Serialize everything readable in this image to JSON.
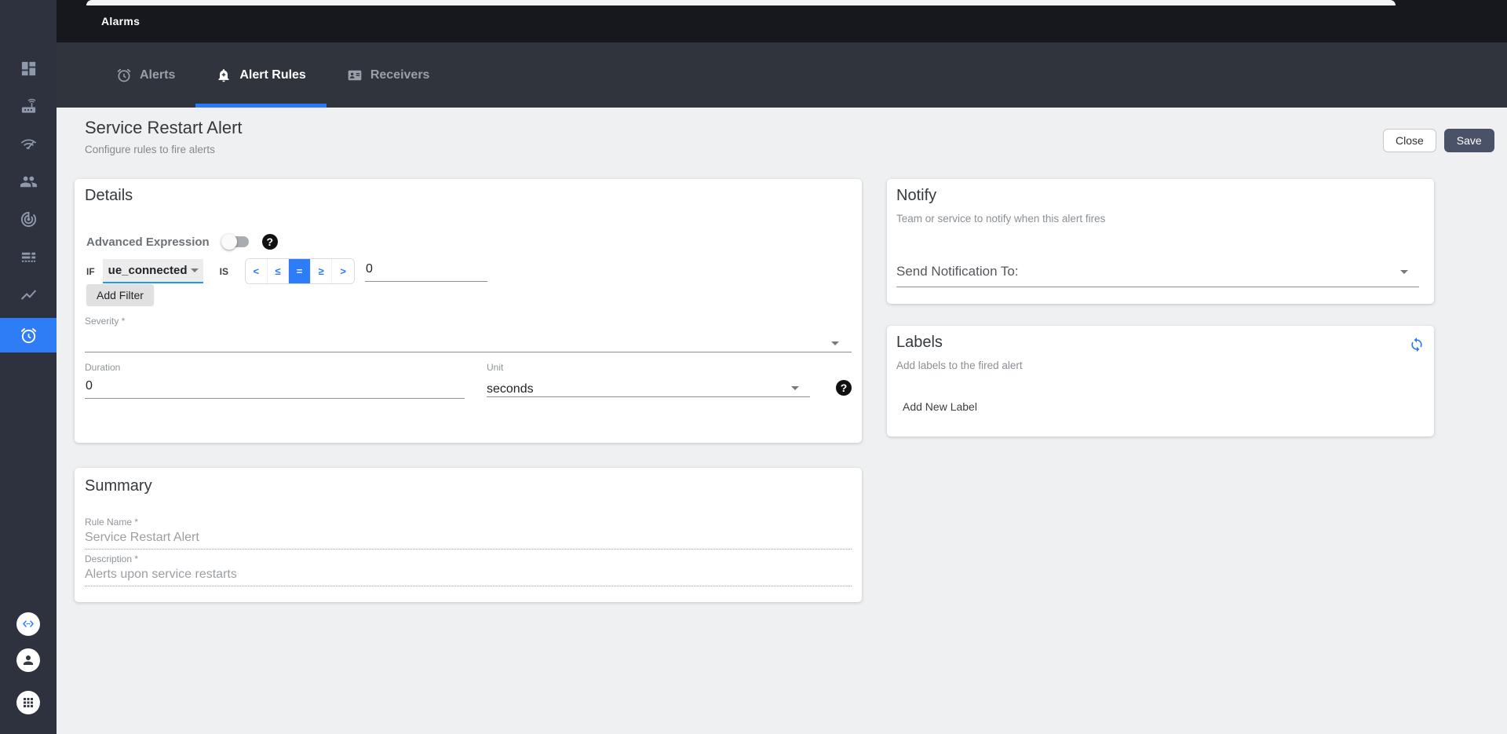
{
  "topbar": {
    "title": "Alarms"
  },
  "tabs": [
    {
      "label": "Alerts",
      "icon": "alarm-clock-icon",
      "active": false
    },
    {
      "label": "Alert Rules",
      "icon": "bell-plus-icon",
      "active": true
    },
    {
      "label": "Receivers",
      "icon": "contact-card-icon",
      "active": false
    }
  ],
  "page_header": {
    "title": "Service Restart Alert",
    "subtitle": "Configure rules to fire alerts",
    "close_label": "Close",
    "save_label": "Save"
  },
  "details": {
    "heading": "Details",
    "advanced_expression_label": "Advanced Expression",
    "if_label": "IF",
    "metric_value": "ue_connected",
    "is_label": "IS",
    "operators": [
      "<",
      "≤",
      "=",
      "≥",
      ">"
    ],
    "selected_operator": "=",
    "threshold_value": "0",
    "add_filter_label": "Add Filter",
    "severity_label": "Severity *",
    "severity_value": "",
    "duration_label": "Duration",
    "duration_value": "0",
    "unit_label": "Unit",
    "unit_value": "seconds"
  },
  "summary": {
    "heading": "Summary",
    "rule_name_label": "Rule Name *",
    "rule_name_value": "Service Restart Alert",
    "description_label": "Description *",
    "description_value": "Alerts upon service restarts"
  },
  "notify": {
    "heading": "Notify",
    "subtitle": "Team or service to notify when this alert fires",
    "send_to_label": "Send Notification To:"
  },
  "labels_card": {
    "heading": "Labels",
    "subtitle": "Add labels to the fired alert",
    "add_new_label": "Add New Label",
    "sync_icon": "sync-icon"
  },
  "sidebar": {
    "icons": [
      "dashboard-icon",
      "router-icon",
      "network-check-icon",
      "users-icon",
      "track-changes-icon",
      "rows-icon",
      "trend-chart-icon",
      "alarm-icon"
    ],
    "active_item": "alarm-icon",
    "bottom_icons": [
      "code-icon",
      "account-icon",
      "apps-grid-icon"
    ]
  },
  "icons": {
    "help_glyph": "?"
  },
  "colors": {
    "accent_blue": "#2979ff",
    "selected_operator_bg": "#2e7df6",
    "sidebar_bg": "#2d323e",
    "topbar_bg": "#16181d",
    "tabbar_bg": "#2f343d",
    "save_button_bg": "#4a5267",
    "page_bg": "#eef0f1",
    "underline_blue": "#2196f3"
  }
}
